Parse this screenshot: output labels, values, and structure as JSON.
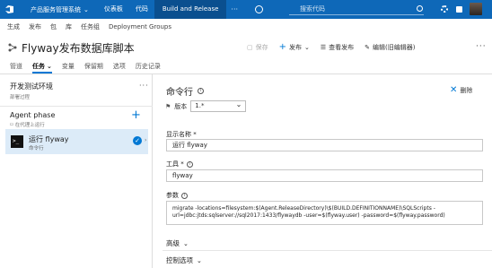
{
  "topbar": {
    "project": "产品服务管理系统",
    "nav": [
      {
        "label": "仪表板"
      },
      {
        "label": "代码"
      },
      {
        "label": "Build and Release"
      }
    ],
    "search_placeholder": "搜索代码",
    "colors": {
      "bar": "#0e68b8",
      "active": "#0a4f8f"
    }
  },
  "subnav": [
    "生成",
    "发布",
    "包",
    "库",
    "任务组",
    "Deployment Groups"
  ],
  "header": {
    "title": "Flyway发布数据库脚本",
    "actions": {
      "save": "保存",
      "publish": "发布",
      "view_release": "查看发布",
      "edit_old": "编辑(旧编辑器)"
    }
  },
  "tabs": [
    {
      "label": "管道",
      "active": false
    },
    {
      "label": "任务",
      "active": true
    },
    {
      "label": "变量",
      "active": false
    },
    {
      "label": "保留期",
      "active": false
    },
    {
      "label": "选项",
      "active": false
    },
    {
      "label": "历史记录",
      "active": false
    }
  ],
  "left_panel": {
    "environment": {
      "name": "开发测试环境",
      "subtitle": "部署过程"
    },
    "phase": {
      "name": "Agent phase",
      "subtitle": "在代理上运行"
    },
    "task": {
      "name": "运行 flyway",
      "subtitle": "命令行",
      "icon_text": ">_"
    }
  },
  "task_editor": {
    "title": "命令行",
    "remove_label": "删除",
    "version_label": "版本",
    "version_value": "1.*",
    "display_name_label": "显示名称 *",
    "display_name_value": "运行 flyway",
    "tool_label": "工具 *",
    "tool_value": "flyway",
    "arguments_label": "参数",
    "arguments_value": "migrate -locations=filesystem:$(Agent.ReleaseDirectory)\\$(BUILD.DEFINITIONNAME)\\SQLScripts -url=jdbc:jtds:sqlserver://sql2017:1433/flywaydb -user=$(flyway.user) -password=$(flyway.password)",
    "advanced_label": "高级",
    "control_label": "控制选项"
  },
  "accent": "#0078d4"
}
